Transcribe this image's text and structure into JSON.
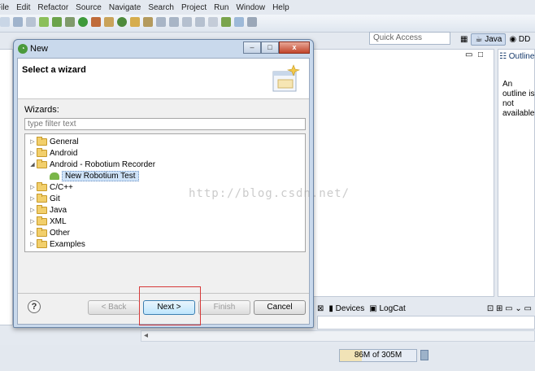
{
  "ide": {
    "menu": [
      "File",
      "Edit",
      "Refactor",
      "Source",
      "Navigate",
      "Search",
      "Project",
      "Run",
      "Window",
      "Help"
    ],
    "quick_access": "Quick Access",
    "perspectives": [
      "Java",
      "DD"
    ],
    "outline_tab": "Outline",
    "outline_message": "An outline is not available.",
    "bottom_tabs": [
      "Devices",
      "LogCat"
    ],
    "heap_status": {
      "label": "86M of 305M",
      "used_mb": 86,
      "total_mb": 305
    }
  },
  "watermark": "http://blog.csdn.net/",
  "dialog": {
    "title": "New",
    "banner_heading": "Select a wizard",
    "wizards_label": "Wizards:",
    "filter_placeholder": "type filter text",
    "tree": [
      {
        "label": "General",
        "expanded": false
      },
      {
        "label": "Android",
        "expanded": false
      },
      {
        "label": "Android - Robotium Recorder",
        "expanded": true
      },
      {
        "label": "New Robotium Test",
        "child": true,
        "selected": true
      },
      {
        "label": "C/C++",
        "expanded": false
      },
      {
        "label": "Git",
        "expanded": false
      },
      {
        "label": "Java",
        "expanded": false
      },
      {
        "label": "XML",
        "expanded": false
      },
      {
        "label": "Other",
        "expanded": false
      },
      {
        "label": "Examples",
        "expanded": false
      }
    ],
    "buttons": {
      "help": "?",
      "back": "< Back",
      "next": "Next >",
      "finish": "Finish",
      "cancel": "Cancel"
    },
    "window_buttons": {
      "minimize": "–",
      "maximize": "□",
      "close": "x"
    }
  }
}
